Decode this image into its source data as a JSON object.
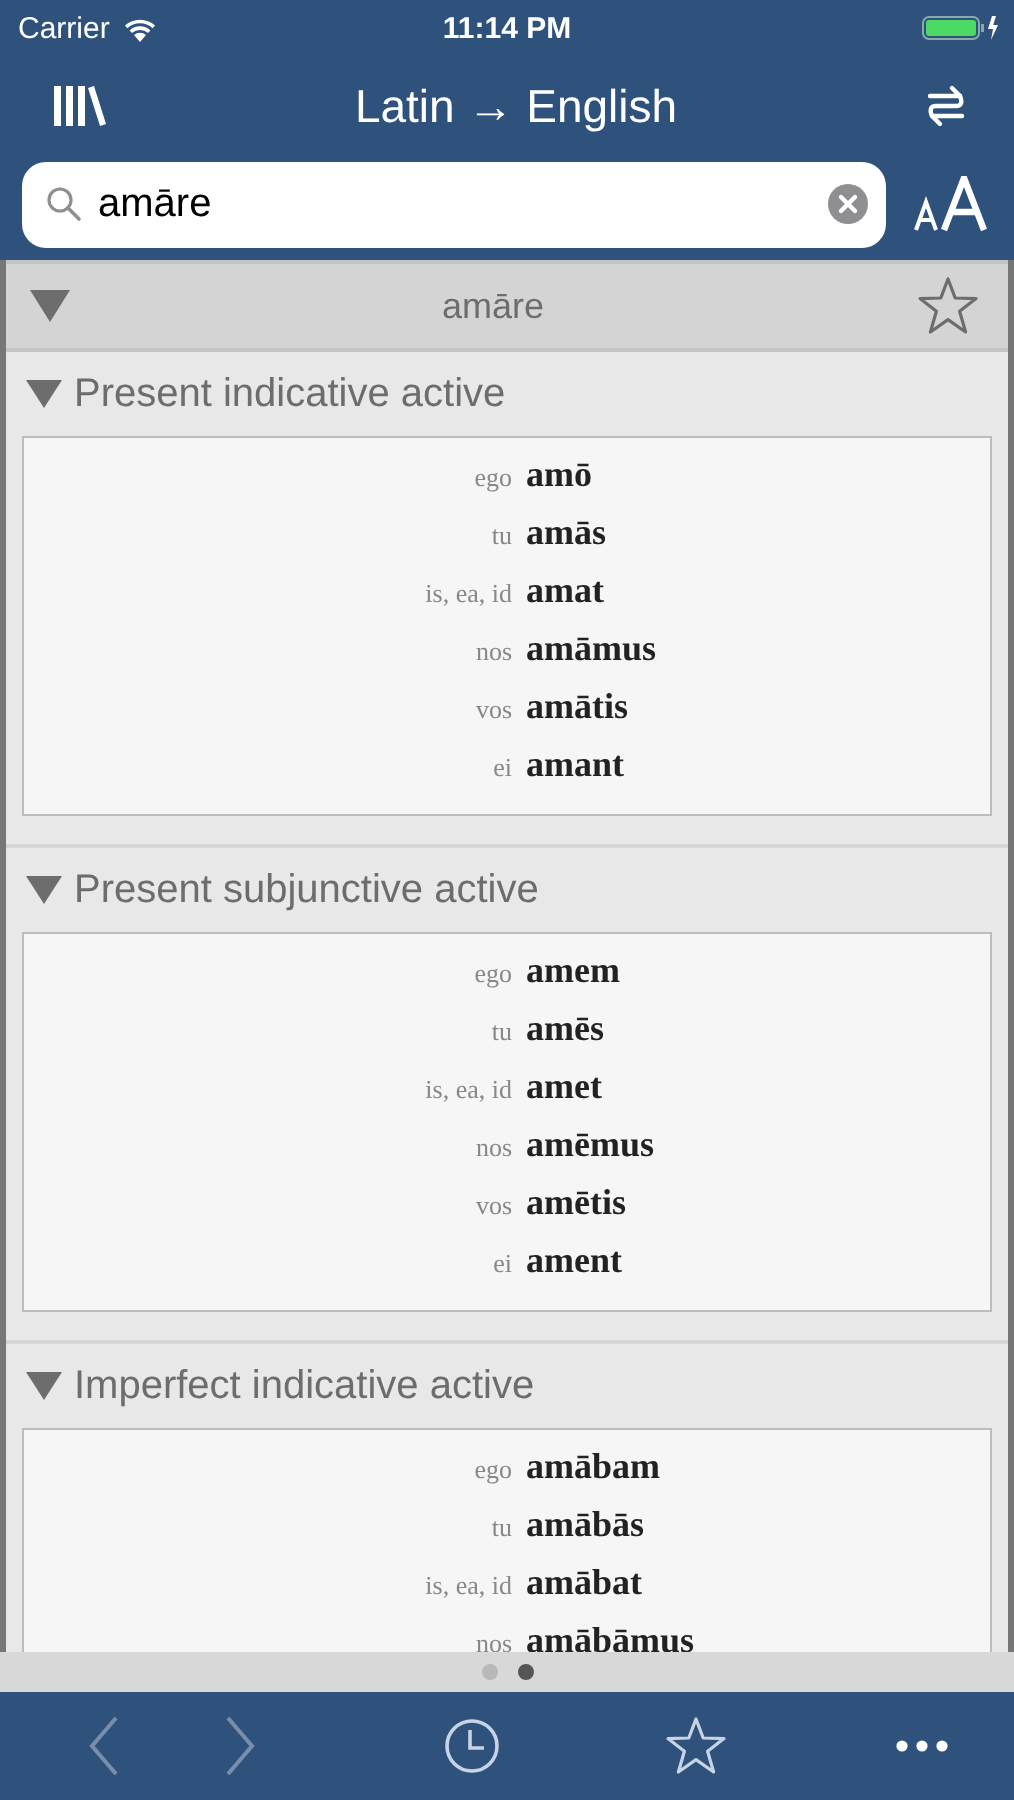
{
  "status_bar": {
    "carrier": "Carrier",
    "time": "11:14 PM"
  },
  "nav": {
    "title": "Latin → English"
  },
  "search": {
    "value": "amāre"
  },
  "entry": {
    "word": "amāre",
    "expanded": true,
    "favorite": false
  },
  "sections": [
    {
      "title": "Present indicative active",
      "expanded": true,
      "rows": [
        {
          "pronoun": "ego",
          "form": "amō"
        },
        {
          "pronoun": "tu",
          "form": "amās"
        },
        {
          "pronoun": "is, ea, id",
          "form": "amat"
        },
        {
          "pronoun": "nos",
          "form": "amāmus"
        },
        {
          "pronoun": "vos",
          "form": "amātis"
        },
        {
          "pronoun": "ei",
          "form": "amant"
        }
      ]
    },
    {
      "title": "Present subjunctive active",
      "expanded": true,
      "rows": [
        {
          "pronoun": "ego",
          "form": "amem"
        },
        {
          "pronoun": "tu",
          "form": "amēs"
        },
        {
          "pronoun": "is, ea, id",
          "form": "amet"
        },
        {
          "pronoun": "nos",
          "form": "amēmus"
        },
        {
          "pronoun": "vos",
          "form": "amētis"
        },
        {
          "pronoun": "ei",
          "form": "ament"
        }
      ]
    },
    {
      "title": "Imperfect indicative active",
      "expanded": true,
      "rows": [
        {
          "pronoun": "ego",
          "form": "amābam"
        },
        {
          "pronoun": "tu",
          "form": "amābās"
        },
        {
          "pronoun": "is, ea, id",
          "form": "amābat"
        },
        {
          "pronoun": "nos",
          "form": "amābāmus"
        }
      ]
    }
  ],
  "pages": [
    {
      "selected": false
    },
    {
      "selected": true
    }
  ],
  "toolbar": {
    "back_disabled": true,
    "forward_disabled": true
  }
}
